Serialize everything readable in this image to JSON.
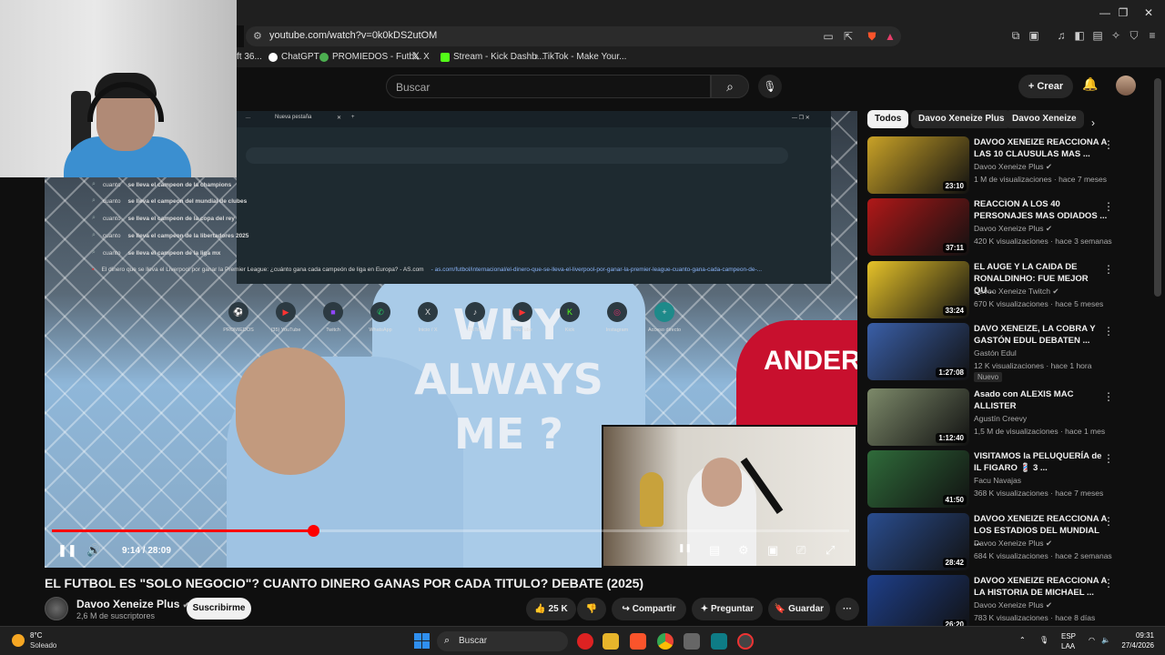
{
  "browser": {
    "url": "youtube.com/watch?v=0k0kDS2utOM",
    "bookmarks": [
      {
        "label": "ft 36...",
        "color": "#888888"
      },
      {
        "label": "ChatGPT",
        "color": "#ffffff"
      },
      {
        "label": "PROMIEDOS - Futb...",
        "color": "#4caf50"
      },
      {
        "label": "X",
        "color": "#ffffff"
      },
      {
        "label": "Stream - Kick Dashb...",
        "color": "#53fc18"
      },
      {
        "label": "TikTok - Make Your...",
        "color": "#ffffff"
      }
    ]
  },
  "header": {
    "search_placeholder": "Buscar",
    "create_label": "Crear"
  },
  "overlay": {
    "tab_label": "Nueva pestaña",
    "suggestions": [
      {
        "prefix": "cuanto",
        "rest": " se lleva el campeon de la champions"
      },
      {
        "prefix": "cuanto",
        "rest": " se lleva el campeon del mundial de clubes"
      },
      {
        "prefix": "cuanto",
        "rest": " se lleva el campeon de la copa del rey"
      },
      {
        "prefix": "cuanto",
        "rest": " se lleva el campeon de la libertadores 2025"
      },
      {
        "prefix": "cuanto",
        "rest": " se lleva el campeon de la liga mx"
      },
      {
        "prefix": "El dinero que se lleva el Liverpool por ganar la Premier League: ¿cuánto gana cada campeón de liga en Europa? - AS.com",
        "rest": " - as.com/futbol/internacional/el-dinero-que-se-lleva-el-liverpool-por-ganar-la-premier-league-cuanto-gana-cada-campeon-de-..."
      }
    ],
    "shortcuts": [
      {
        "label": "PROMIEDOS",
        "icon": "⚽"
      },
      {
        "label": "(35) YouTube",
        "icon": "▶"
      },
      {
        "label": "Twitch",
        "icon": "■"
      },
      {
        "label": "WhatsApp",
        "icon": "✆"
      },
      {
        "label": "Inicio / X",
        "icon": "X"
      },
      {
        "label": "TikTok",
        "icon": "♪"
      },
      {
        "label": "YouTube",
        "icon": "▶"
      },
      {
        "label": "Kick",
        "icon": "K"
      },
      {
        "label": "Instagram",
        "icon": "◎"
      },
      {
        "label": "Acceso directo",
        "icon": "+"
      }
    ]
  },
  "video_overlay_text": {
    "main": "WHY\nALWAYS\nME ?",
    "jersey": "ANDER"
  },
  "player": {
    "time": "9:14 / 28:09",
    "progress": 0.328
  },
  "video": {
    "title": "EL FUTBOL ES \"SOLO NEGOCIO\"? CUANTO DINERO GANAS POR CADA TITULO? DEBATE (2025)",
    "channel": "Davoo Xeneize Plus",
    "subscribers": "2,6 M de suscriptores",
    "subscribe_label": "Suscribirme",
    "likes": "25 K",
    "share_label": "Compartir",
    "ask_label": "Preguntar",
    "save_label": "Guardar"
  },
  "chips": [
    "Todos",
    "Davoo Xeneize Plus",
    "Davoo Xeneize"
  ],
  "recommendations": [
    {
      "title": "DAVOO XENEIZE REACCIONA A LAS 10 CLAUSULAS MAS ...",
      "channel": "Davoo Xeneize Plus",
      "verified": true,
      "meta": "1 M de visualizaciones · hace 7 meses",
      "duration": "23:10",
      "thumb": "#c9a227",
      "badge": ""
    },
    {
      "title": "REACCION A LOS 40 PERSONAJES MAS ODIADOS ...",
      "channel": "Davoo Xeneize Plus",
      "verified": true,
      "meta": "420 K visualizaciones · hace 3 semanas",
      "duration": "37:11",
      "thumb": "#b01818",
      "badge": ""
    },
    {
      "title": "EL AUGE Y LA CAIDA DE RONALDINHO: FUE MEJOR QU...",
      "channel": "Davoo Xeneize Twitch",
      "verified": true,
      "meta": "670 K visualizaciones · hace 5 meses",
      "duration": "33:24",
      "thumb": "#e6c229",
      "badge": ""
    },
    {
      "title": "DAVO XENEIZE, LA COBRA Y GASTÓN EDUL DEBATEN ...",
      "channel": "Gastón Edul",
      "verified": false,
      "meta": "12 K visualizaciones · hace 1 hora",
      "duration": "1:27:08",
      "thumb": "#3a5fa8",
      "badge": "Nuevo"
    },
    {
      "title": "Asado con ALEXIS MAC ALLISTER",
      "channel": "Agustín Creevy",
      "verified": false,
      "meta": "1,5 M de visualizaciones · hace 1 mes",
      "duration": "1:12:40",
      "thumb": "#7d8a6a",
      "badge": ""
    },
    {
      "title": "VISITAMOS la PELUQUERÍA de IL FIGARO 💈 3 ...",
      "channel": "Facu Navajas",
      "verified": false,
      "meta": "368 K visualizaciones · hace 7 meses",
      "duration": "41:50",
      "thumb": "#2f6b3a",
      "badge": ""
    },
    {
      "title": "DAVOO XENEIZE REACCIONA A LOS ESTADIOS DEL MUNDIAL ...",
      "channel": "Davoo Xeneize Plus",
      "verified": true,
      "meta": "684 K visualizaciones · hace 2 semanas",
      "duration": "28:42",
      "thumb": "#2a4d8f",
      "badge": ""
    },
    {
      "title": "DAVOO XENEIZE REACCIONA A LA HISTORIA DE MICHAEL ...",
      "channel": "Davoo Xeneize Plus",
      "verified": true,
      "meta": "783 K visualizaciones · hace 8 días",
      "duration": "26:20",
      "thumb": "#1e3f8a",
      "badge": ""
    }
  ],
  "taskbar": {
    "temperature": "8°C",
    "weather": "Soleado",
    "search_label": "Buscar",
    "lang": "ESP",
    "lang2": "LAA",
    "time": "09:31",
    "date": "27/4/2026"
  }
}
